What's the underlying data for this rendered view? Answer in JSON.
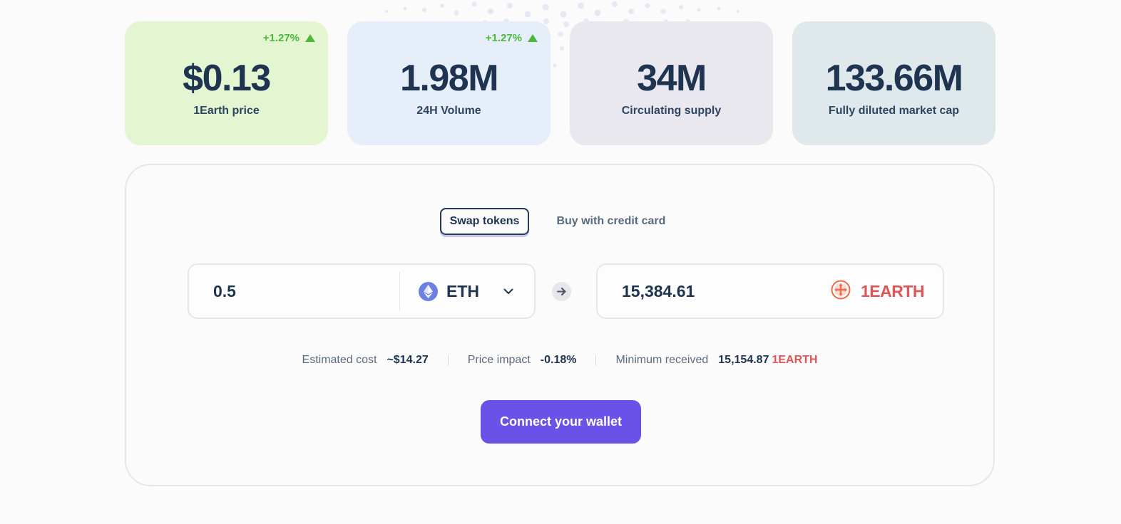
{
  "stats": [
    {
      "value": "$0.13",
      "label": "1Earth price",
      "change": "+1.27%",
      "bg": "#e4f5d2"
    },
    {
      "value": "1.98M",
      "label": "24H Volume",
      "change": "+1.27%",
      "bg": "#e6eef9"
    },
    {
      "value": "34M",
      "label": "Circulating supply",
      "change": "",
      "bg": "#e9e8ef"
    },
    {
      "value": "133.66M",
      "label": "Fully diluted market cap",
      "change": "",
      "bg": "#dfe9ec"
    }
  ],
  "tabs": {
    "swap_label": "Swap tokens",
    "card_label": "Buy with credit card"
  },
  "swap": {
    "from_amount": "0.5",
    "from_token": "ETH",
    "from_token_icon": "ethereum-icon",
    "to_amount": "15,384.61",
    "to_token": "1EARTH",
    "to_token_icon": "1earth-logo-icon"
  },
  "details": {
    "estimated_cost_label": "Estimated cost",
    "estimated_cost_value": "~$14.27",
    "price_impact_label": "Price impact",
    "price_impact_value": "-0.18%",
    "minimum_received_label": "Minimum received",
    "minimum_received_value": "15,154.87",
    "minimum_received_unit": "1EARTH"
  },
  "connect_button_label": "Connect your wallet",
  "colors": {
    "accent": "#6a52e8",
    "positive": "#4cb83a",
    "earth_red": "#e05555",
    "text_dark": "#1e3450"
  }
}
